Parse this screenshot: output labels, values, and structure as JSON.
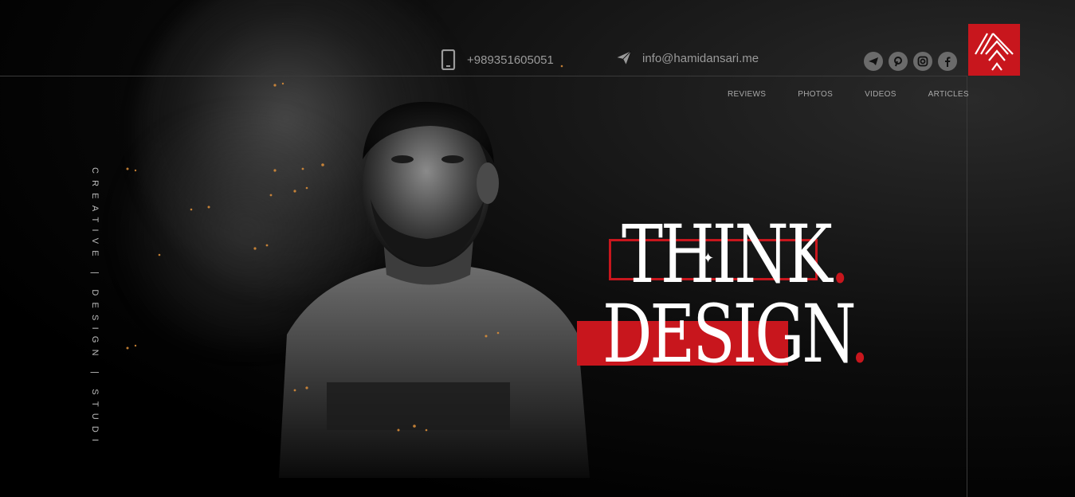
{
  "header": {
    "phone": "+989351605051",
    "email": "info@hamidansari.me",
    "socials": [
      "telegram-icon",
      "pinterest-icon",
      "instagram-icon",
      "facebook-icon"
    ]
  },
  "nav": {
    "items": [
      {
        "label": "REVIEWS"
      },
      {
        "label": "PHOTOS"
      },
      {
        "label": "VIDEOS"
      },
      {
        "label": "ARTICLES"
      }
    ]
  },
  "tagline_vertical": "CREATIVE | DESIGN | STUDI",
  "hero": {
    "line1": "THINK",
    "line2": "DESIGN",
    "dot": "."
  },
  "colors": {
    "accent": "#c8161d",
    "background": "#000000",
    "text_muted": "#9a9a9a"
  }
}
